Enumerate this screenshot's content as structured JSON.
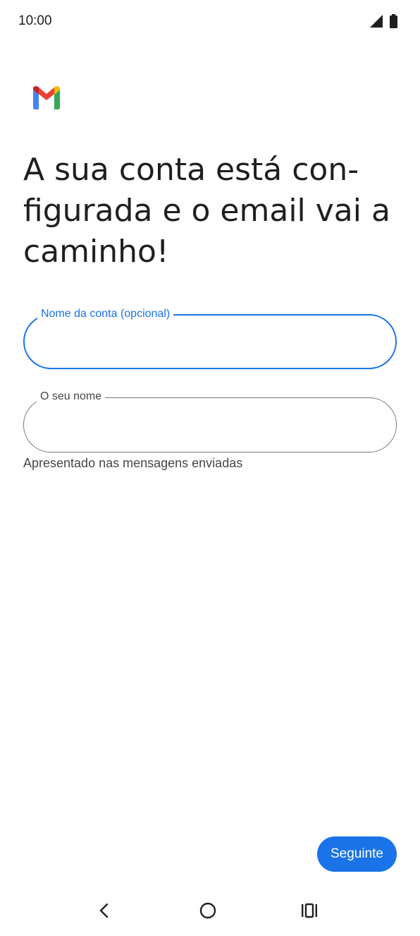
{
  "status_bar": {
    "time": "10:00",
    "icons": [
      "signal-icon",
      "battery-icon"
    ]
  },
  "logo": {
    "name": "gmail-logo",
    "colors": {
      "blue": "#4285F4",
      "red": "#EA4335",
      "yellow": "#FBBC04",
      "green": "#34A853",
      "dark_red": "#C5221F"
    }
  },
  "title": "A sua conta está con-figurada e o email vai a caminho!",
  "fields": {
    "account_name": {
      "label": "Nome da conta (opcional)",
      "value": "",
      "focused": true
    },
    "your_name": {
      "label": "O seu nome",
      "value": "",
      "helper": "Apresentado nas mensagens enviadas"
    }
  },
  "next_button": {
    "label": "Seguinte"
  },
  "nav_bar": {
    "icons": [
      "back-icon",
      "home-icon",
      "recents-icon"
    ]
  },
  "colors": {
    "accent": "#1a73e8",
    "text": "#1f1f1f",
    "muted": "#444746",
    "outline": "#747775"
  }
}
